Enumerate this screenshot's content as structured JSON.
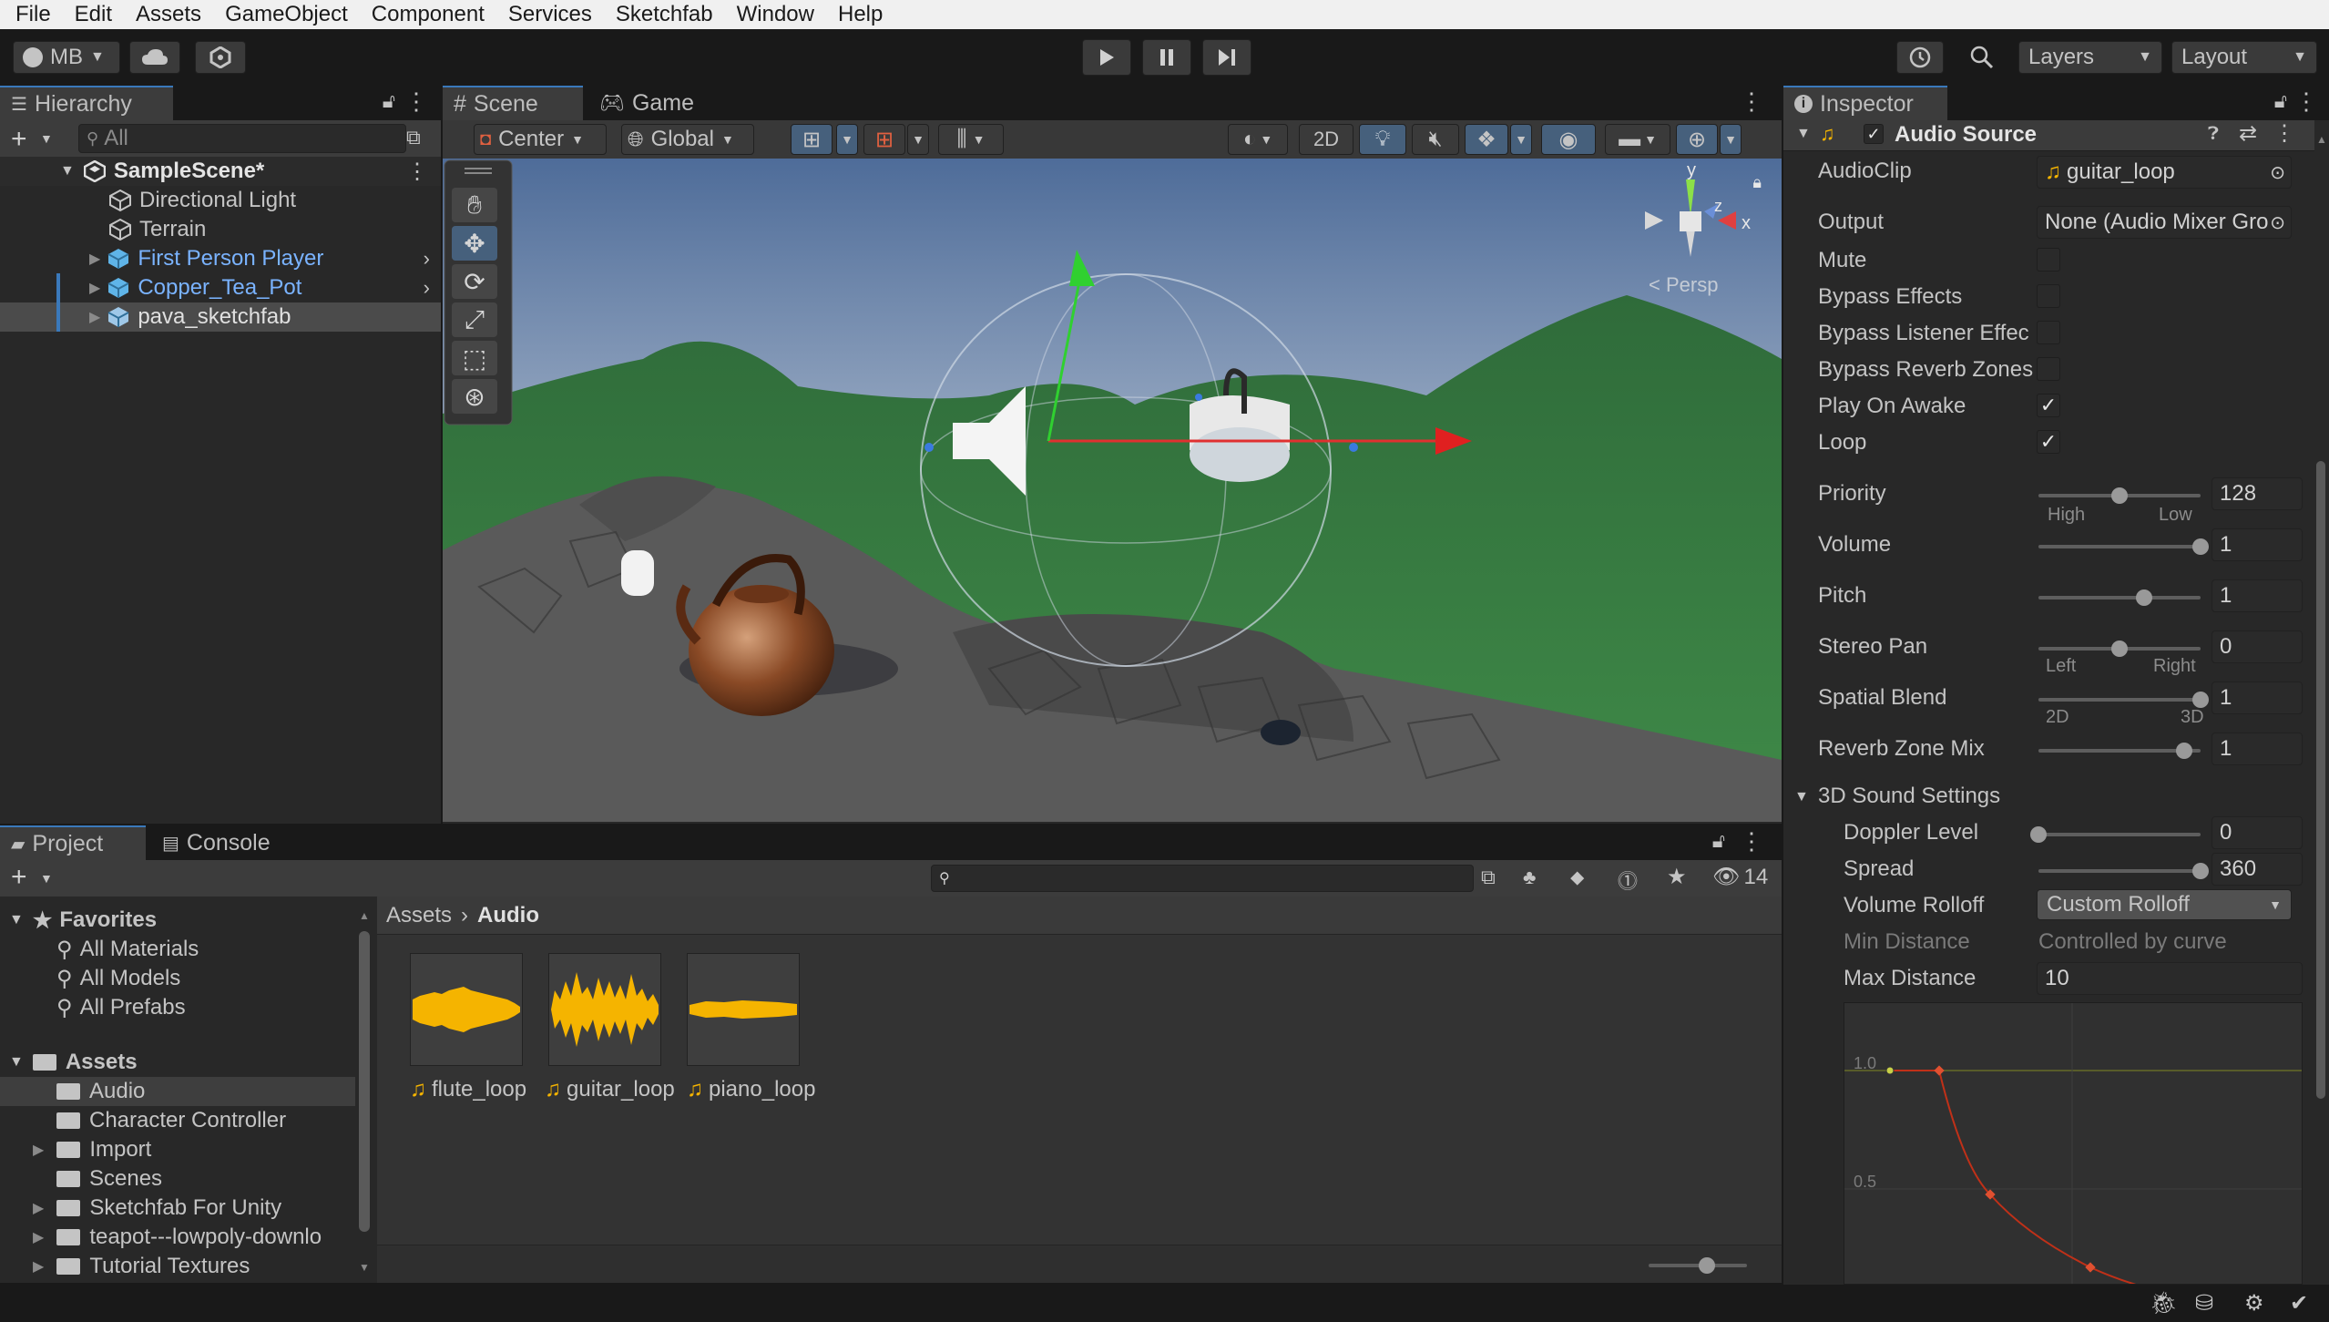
{
  "menu": [
    "File",
    "Edit",
    "Assets",
    "GameObject",
    "Component",
    "Services",
    "Sketchfab",
    "Window",
    "Help"
  ],
  "toolbar": {
    "account": "MB",
    "layers": "Layers",
    "layout": "Layout"
  },
  "hierarchy": {
    "tab": "Hierarchy",
    "search_placeholder": "All",
    "scene": "SampleScene*",
    "items": [
      {
        "label": "Directional Light"
      },
      {
        "label": "Terrain"
      },
      {
        "label": "First Person Player"
      },
      {
        "label": "Copper_Tea_Pot"
      },
      {
        "label": "pava_sketchfab"
      }
    ]
  },
  "scene": {
    "tabs": [
      "Scene",
      "Game"
    ],
    "pivot": "Center",
    "space": "Global",
    "mode2d": "2D",
    "gizmo": {
      "y": "y",
      "x": "x",
      "z": "z",
      "view": "< Persp"
    }
  },
  "project": {
    "tabs": [
      "Project",
      "Console"
    ],
    "hidden_count": "14",
    "favorites_title": "Favorites",
    "favorites": [
      "All Materials",
      "All Models",
      "All Prefabs"
    ],
    "assets_title": "Assets",
    "folders": [
      "Audio",
      "Character Controller",
      "Import",
      "Scenes",
      "Sketchfab For Unity",
      "teapot---lowpoly-downlo",
      "Tutorial Textures"
    ],
    "breadcrumb": [
      "Assets",
      "Audio"
    ],
    "files": [
      "flute_loop",
      "guitar_loop",
      "piano_loop"
    ]
  },
  "inspector": {
    "tab": "Inspector",
    "component": "Audio Source",
    "fields": {
      "audioclip_label": "AudioClip",
      "audioclip": "guitar_loop",
      "output_label": "Output",
      "output": "None (Audio Mixer Gro",
      "mute": "Mute",
      "bypass_effects": "Bypass Effects",
      "bypass_listener": "Bypass Listener Effec",
      "bypass_reverb": "Bypass Reverb Zones",
      "play_on_awake": "Play On Awake",
      "loop": "Loop",
      "priority_label": "Priority",
      "priority": "128",
      "high": "High",
      "low": "Low",
      "volume_label": "Volume",
      "volume": "1",
      "pitch_label": "Pitch",
      "pitch": "1",
      "stereo_label": "Stereo Pan",
      "stereo": "0",
      "left": "Left",
      "right": "Right",
      "spatial_label": "Spatial Blend",
      "spatial": "1",
      "s2d": "2D",
      "s3d": "3D",
      "reverb_mix_label": "Reverb Zone Mix",
      "reverb_mix": "1",
      "sound3d": "3D Sound Settings",
      "doppler_label": "Doppler Level",
      "doppler": "0",
      "spread_label": "Spread",
      "spread": "360",
      "rolloff_label": "Volume Rolloff",
      "rolloff": "Custom Rolloff",
      "min_label": "Min Distance",
      "min": "Controlled by curve",
      "max_label": "Max Distance",
      "max": "10",
      "curve_10": "1.0",
      "curve_05": "0.5"
    },
    "slider_levels": {
      "priority": 0.5,
      "volume": 1.0,
      "pitch": 0.65,
      "stereo": 0.5,
      "spatial": 1.0,
      "reverb": 0.9,
      "doppler": 0.0,
      "spread": 1.0
    }
  },
  "colors": {
    "accent": "#3a79bb",
    "link": "#7ab3ff",
    "audio": "#f5b400"
  }
}
